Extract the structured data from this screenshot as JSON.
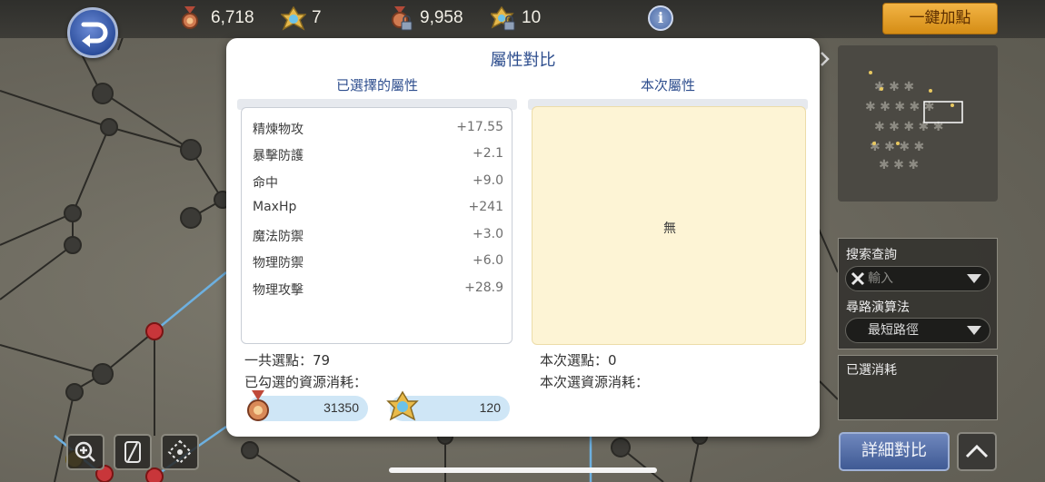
{
  "topbar": {
    "resources": [
      {
        "icon": "medal-icon",
        "value": "6,718"
      },
      {
        "icon": "gear-crystal-icon",
        "value": "7"
      },
      {
        "icon": "locked-medal-icon",
        "value": "9,958"
      },
      {
        "icon": "locked-crystal-icon",
        "value": "10"
      }
    ],
    "info_label": "i",
    "auto_button": "一鍵加點"
  },
  "modal": {
    "title": "屬性對比",
    "left_header": "已選擇的屬性",
    "right_header": "本次屬性",
    "attributes": [
      {
        "name": "精煉物攻",
        "value": "+17.55"
      },
      {
        "name": "暴擊防護",
        "value": "+2.1"
      },
      {
        "name": "命中",
        "value": "+9.0"
      },
      {
        "name": "MaxHp",
        "value": "+241"
      },
      {
        "name": "魔法防禦",
        "value": "+3.0"
      },
      {
        "name": "物理防禦",
        "value": "+6.0"
      },
      {
        "name": "物理攻擊",
        "value": "+28.9"
      }
    ],
    "current_empty": "無",
    "total_points_label": "一共選點：79",
    "checked_cost_label": "已勾選的資源消耗：",
    "current_points_label": "本次選點：0",
    "current_cost_label": "本次選資源消耗：",
    "costs": [
      {
        "icon": "medal-icon",
        "value": "31350"
      },
      {
        "icon": "gear-crystal-icon",
        "value": "120"
      }
    ]
  },
  "side": {
    "search_label": "搜索查詢",
    "search_placeholder": "輸入",
    "algo_label": "尋路演算法",
    "algo_value": "最短路徑",
    "cost_label": "已選消耗",
    "detail_button": "詳細對比"
  },
  "colors": {
    "title_blue": "#2e4e8e",
    "gold_button": "#e3a12c",
    "cost_pill": "#cfe6f6",
    "current_box": "#fdf4d5"
  }
}
